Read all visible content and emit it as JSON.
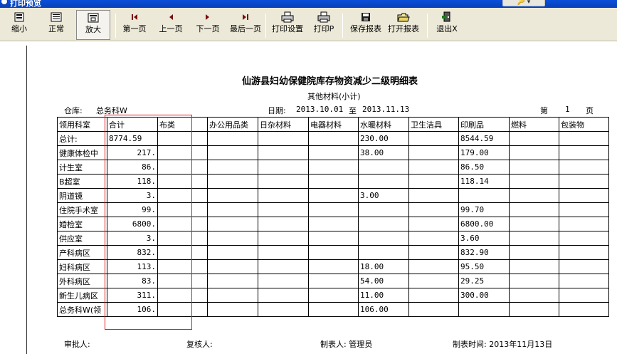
{
  "window": {
    "title": "打印预览",
    "controls": "🔑 ▾"
  },
  "toolbar": {
    "zoom_out": "缩小",
    "normal": "正常",
    "zoom_in": "放大",
    "first_page": "第一页",
    "prev_page": "上一页",
    "next_page": "下一页",
    "last_page": "最后一页",
    "print_setup": "打印设置",
    "print": "打印P",
    "save_report": "保存报表",
    "open_report": "打开报表",
    "exit": "退出X"
  },
  "report": {
    "title": "仙游县妇幼保健院库存物资减少二级明细表",
    "subtitle": "其他材料(小计)",
    "warehouse_label": "仓库:",
    "warehouse": "总务科W",
    "date_label": "日期:",
    "date_from": "2013.10.01",
    "date_to_word": "至",
    "date_to": "2013.11.13",
    "page_label_pre": "第",
    "page_number": "1",
    "page_label_post": "页",
    "columns": [
      "领用科室",
      "合计",
      "布类",
      "办公用品类",
      "日杂材料",
      "电器材料",
      "水暖材料",
      "卫生洁具",
      "印刷品",
      "燃料",
      "包装物"
    ],
    "rows": [
      [
        "总计:",
        "8774.59",
        "",
        "",
        "",
        "",
        "230.00",
        "",
        "8544.59",
        "",
        ""
      ],
      [
        "健康体检中",
        "217.",
        "",
        "",
        "",
        "",
        "38.00",
        "",
        "179.00",
        "",
        ""
      ],
      [
        "计生室",
        "86.",
        "",
        "",
        "",
        "",
        "",
        "",
        "86.50",
        "",
        ""
      ],
      [
        "B超室",
        "118.",
        "",
        "",
        "",
        "",
        "",
        "",
        "118.14",
        "",
        ""
      ],
      [
        "阴道镜",
        "3.",
        "",
        "",
        "",
        "",
        "3.00",
        "",
        "",
        "",
        ""
      ],
      [
        "住院手术室",
        "99.",
        "",
        "",
        "",
        "",
        "",
        "",
        "99.70",
        "",
        ""
      ],
      [
        "婚检室",
        "6800.",
        "",
        "",
        "",
        "",
        "",
        "",
        "6800.00",
        "",
        ""
      ],
      [
        "供应室",
        "3.",
        "",
        "",
        "",
        "",
        "",
        "",
        "3.60",
        "",
        ""
      ],
      [
        "产科病区",
        "832.",
        "",
        "",
        "",
        "",
        "",
        "",
        "832.90",
        "",
        ""
      ],
      [
        "妇科病区",
        "113.",
        "",
        "",
        "",
        "",
        "18.00",
        "",
        "95.50",
        "",
        ""
      ],
      [
        "外科病区",
        "83.",
        "",
        "",
        "",
        "",
        "54.00",
        "",
        "29.25",
        "",
        ""
      ],
      [
        "新生儿病区",
        "311.",
        "",
        "",
        "",
        "",
        "11.00",
        "",
        "300.00",
        "",
        ""
      ],
      [
        "总务科W(领",
        "106.",
        "",
        "",
        "",
        "",
        "106.00",
        "",
        "",
        "",
        ""
      ]
    ],
    "footer": {
      "approver": "审批人:",
      "reviewer": "复核人:",
      "maker": "制表人: 管理员",
      "made_time": "制表时间: 2013年11月13日"
    }
  },
  "colors": {
    "highlight": "#e02020",
    "titlebar": "#0a4fd8",
    "toolbar": "#ece9d8"
  }
}
